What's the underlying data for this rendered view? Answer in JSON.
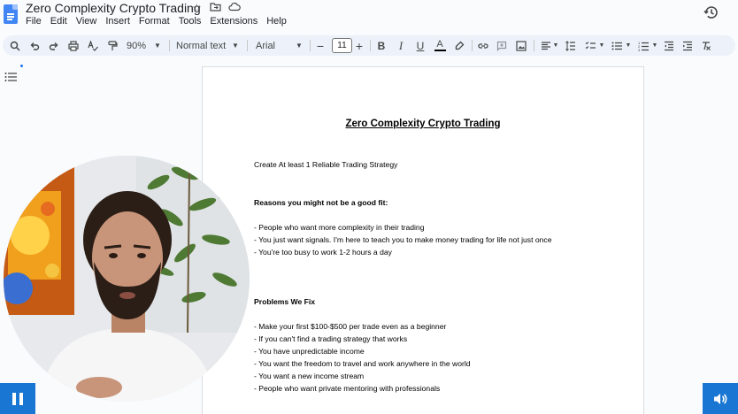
{
  "app": {
    "doc_title": "Zero Complexity Crypto Trading",
    "menu": [
      "File",
      "Edit",
      "View",
      "Insert",
      "Format",
      "Tools",
      "Extensions",
      "Help"
    ]
  },
  "toolbar": {
    "zoom": "90%",
    "style": "Normal text",
    "font": "Arial",
    "font_size": "11",
    "minus": "−",
    "plus": "+",
    "text_color_icon_letter": "A"
  },
  "document": {
    "heading": "Zero Complexity Crypto Trading",
    "subtitle": "Create At least 1 Reliable Trading Strategy",
    "section1_title": "Reasons you might not be a good fit:",
    "section1_items": [
      "- People who want more complexity in their trading",
      "- You just want signals. I'm here to teach you to make money trading for life not just once",
      "- You're too busy to work 1-2 hours a day"
    ],
    "section2_title": "Problems We Fix",
    "section2_items": [
      "- Make your first $100-$500 per trade even as a beginner",
      "- If you can't find a trading strategy that works",
      "- You have unpredictable income",
      "- You want the freedom to travel and work anywhere in the world",
      "- You want a new income stream",
      "- People who want private mentoring with professionals"
    ]
  },
  "colors": {
    "accent": "#1976d2",
    "toolbar_bg": "#edf2fa",
    "doc_blue": "#4285f4"
  }
}
